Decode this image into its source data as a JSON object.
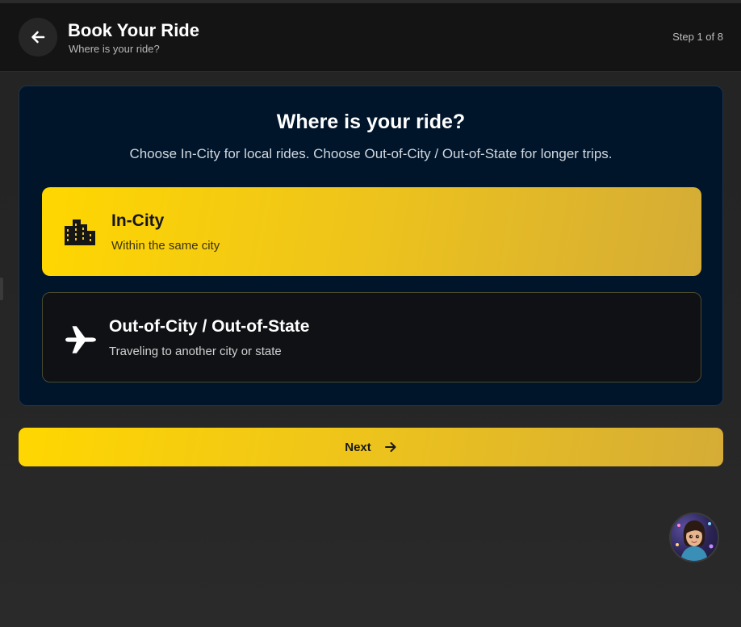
{
  "header": {
    "title": "Book Your Ride",
    "subtitle": "Where is your ride?",
    "step": "Step 1 of 8",
    "back_icon": "arrow-left-icon"
  },
  "main": {
    "heading": "Where is your ride?",
    "description": "Choose In-City for local rides. Choose Out-of-City / Out-of-State for longer trips.",
    "options": [
      {
        "title": "In-City",
        "description": "Within the same city",
        "icon": "city-buildings-icon",
        "selected": true
      },
      {
        "title": "Out-of-City / Out-of-State",
        "description": "Traveling to another city or state",
        "icon": "airplane-icon",
        "selected": false
      }
    ]
  },
  "footer": {
    "next_label": "Next",
    "next_icon": "arrow-right-icon"
  },
  "assistant": {
    "avatar_icon": "assistant-avatar"
  },
  "colors": {
    "accent_start": "#ffd700",
    "accent_end": "#d5ac36",
    "panel_bg": "#00152a",
    "header_bg": "#141414"
  }
}
